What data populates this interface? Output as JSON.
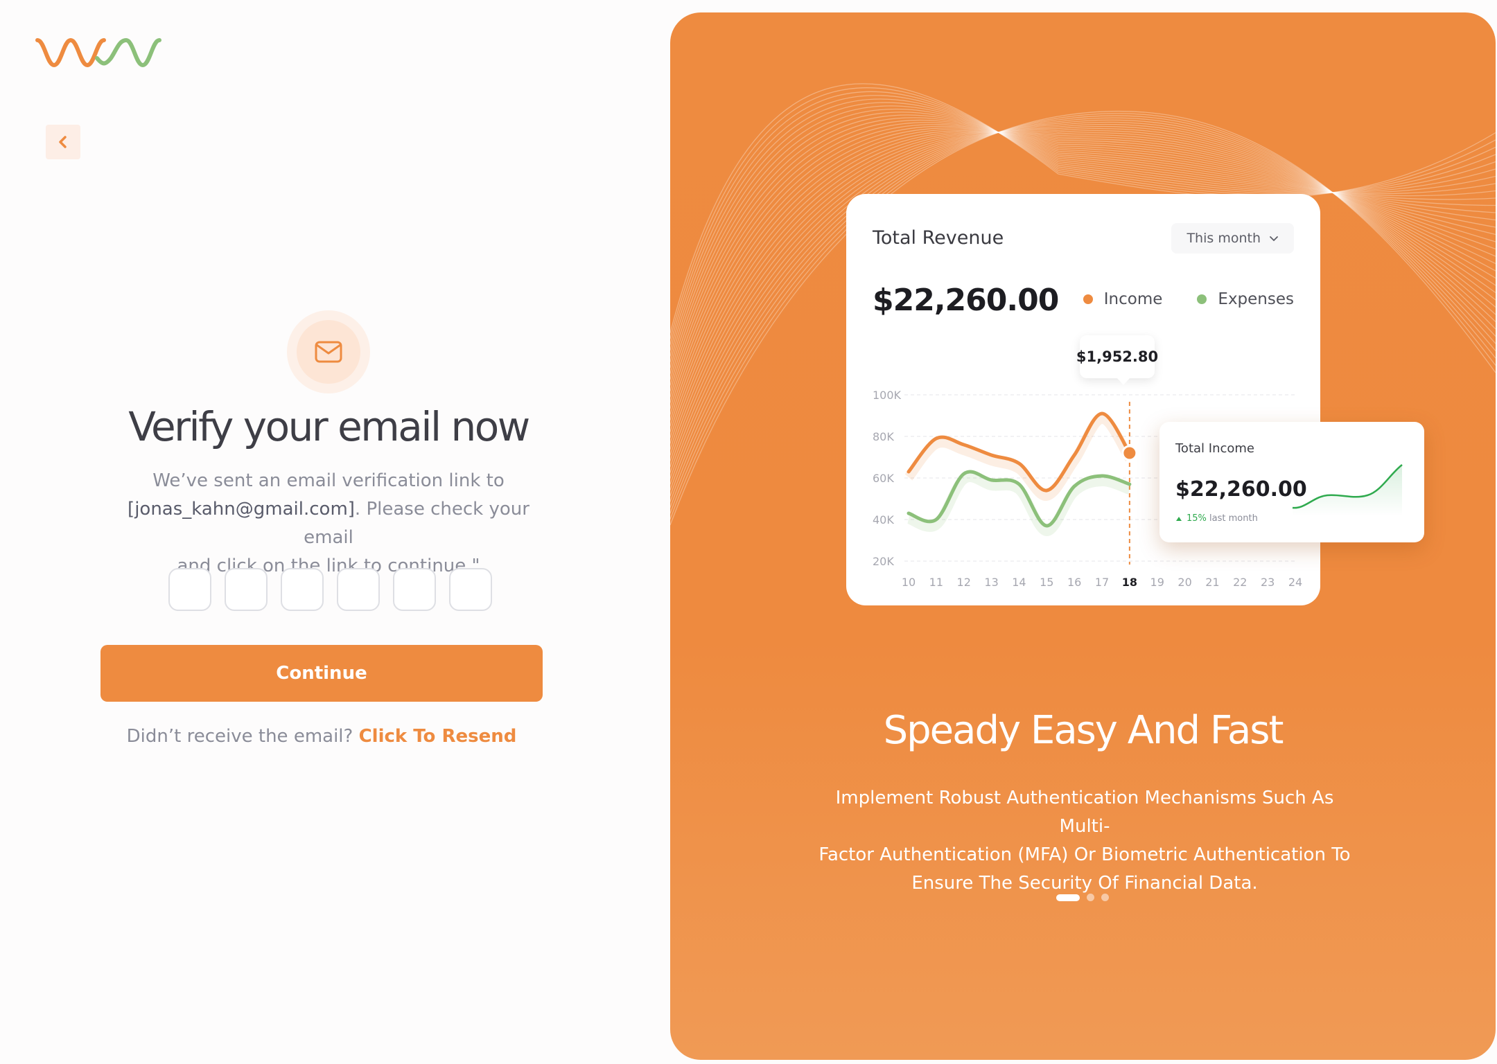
{
  "logo": {
    "name": "brand-logo",
    "colors": [
      "#ee8b40",
      "#8cc07a"
    ]
  },
  "back": {
    "icon": "chevron-left-icon"
  },
  "verify": {
    "icon": "mail-icon",
    "title": "Verify your email now",
    "desc_line1": "We’ve sent an email verification link to",
    "email": "[jonas_kahn@gmail.com]",
    "desc_line2_rest": ". Please check your email",
    "desc_line3": "and click on the link to continue.\"",
    "otp_values": [
      "",
      "",
      "",
      "",
      "",
      ""
    ],
    "continue_label": "Continue",
    "resend_prompt": "Didn’t receive the email? ",
    "resend_link": "Click To Resend"
  },
  "promo": {
    "card": {
      "title": "Total Revenue",
      "period": "This month",
      "amount": "$22,260.00",
      "legend": [
        {
          "label": "Income",
          "color": "#ee8b40"
        },
        {
          "label": "Expenses",
          "color": "#8cc07a"
        }
      ],
      "tooltip": "$1,952.80"
    },
    "income_card": {
      "label": "Total Income",
      "amount": "$22,260.00",
      "change": "15%",
      "change_suffix": " last month"
    },
    "headline": "Speady Easy And Fast",
    "desc_line1": "Implement Robust Authentication Mechanisms Such As Multi-",
    "desc_line2": "Factor Authentication (MFA) Or Biometric Authentication To",
    "desc_line3": "Ensure The Security Of Financial Data.",
    "slides": {
      "count": 3,
      "active": 0
    }
  },
  "chart_data": {
    "type": "line",
    "title": "Total Revenue",
    "x": [
      10,
      11,
      12,
      13,
      14,
      15,
      16,
      17,
      18,
      19,
      20,
      21,
      22,
      23,
      24
    ],
    "x_tick_labels": [
      "10",
      "11",
      "12",
      "13",
      "14",
      "15",
      "16",
      "17",
      "18",
      "19",
      "20",
      "21",
      "22",
      "23",
      "24"
    ],
    "highlight_x": 18,
    "y_tick_labels": [
      "100K",
      "80K",
      "60K",
      "40K",
      "20K"
    ],
    "ylim": [
      20000,
      100000
    ],
    "series": [
      {
        "name": "Income",
        "color": "#ee8b40",
        "values": [
          63000,
          79000,
          76000,
          71000,
          67000,
          54000,
          71000,
          91000,
          72000
        ]
      },
      {
        "name": "Expenses",
        "color": "#8cc07a",
        "values": [
          43000,
          40000,
          62000,
          59000,
          57000,
          37000,
          56000,
          61000,
          57000
        ]
      }
    ],
    "grid": true,
    "legend_position": "top-right"
  }
}
